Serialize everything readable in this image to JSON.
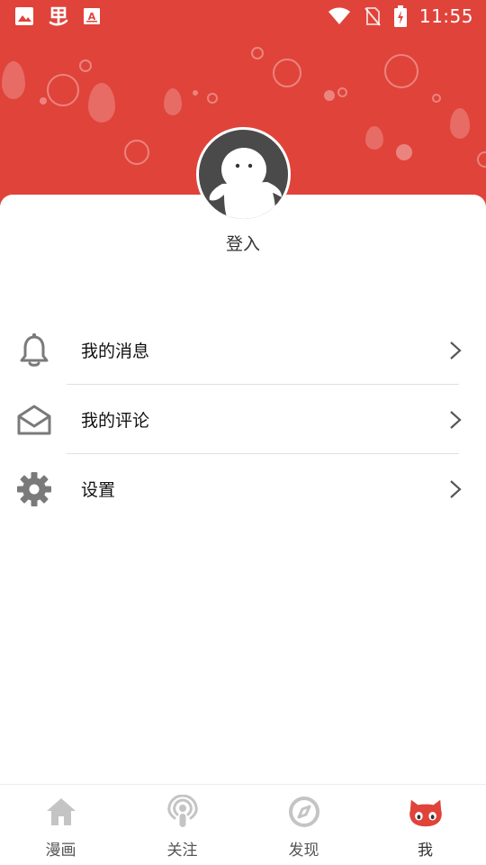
{
  "status_bar": {
    "time": "11:55",
    "left_icons": [
      "image-icon",
      "app-logo-icon",
      "text-a-icon"
    ],
    "right_icons": [
      "wifi-icon",
      "no-sim-icon",
      "battery-charging-icon"
    ]
  },
  "profile": {
    "login_label": "登入"
  },
  "menu": {
    "items": [
      {
        "label": "我的消息",
        "icon": "bell-icon"
      },
      {
        "label": "我的评论",
        "icon": "envelope-icon"
      },
      {
        "label": "设置",
        "icon": "gear-icon"
      }
    ]
  },
  "bottom_nav": {
    "items": [
      {
        "label": "漫画",
        "icon": "home-icon"
      },
      {
        "label": "关注",
        "icon": "podcast-icon"
      },
      {
        "label": "发现",
        "icon": "compass-icon"
      },
      {
        "label": "我",
        "icon": "cat-face-icon",
        "active": true
      }
    ]
  },
  "colors": {
    "header_red": "#e0433a",
    "icon_gray": "#7a7a7a",
    "nav_icon_gray": "#c4c4c4",
    "active_red": "#e0433a"
  }
}
